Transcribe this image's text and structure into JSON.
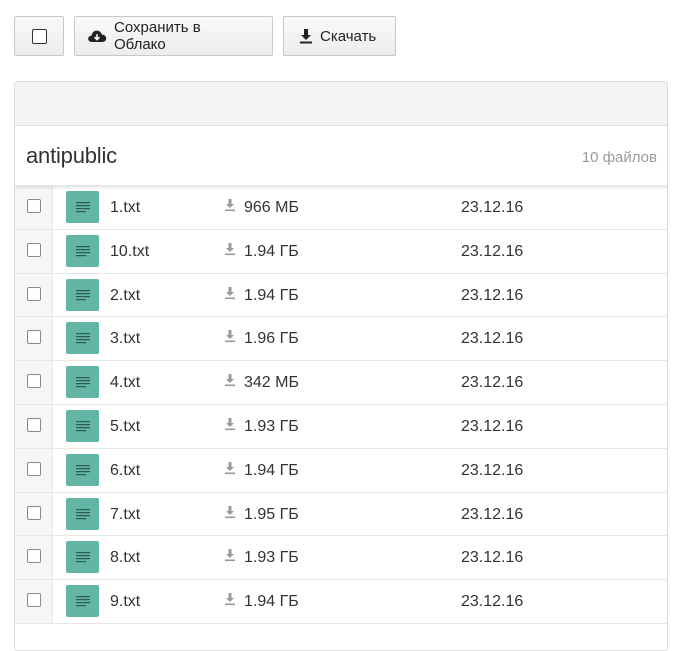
{
  "toolbar": {
    "save_label": "Сохранить в Облако",
    "download_label": "Скачать"
  },
  "folder": {
    "name": "antipublic",
    "count": "10 файлов"
  },
  "files": [
    {
      "name": "1.txt",
      "size": "966 МБ",
      "date": "23.12.16"
    },
    {
      "name": "10.txt",
      "size": "1.94 ГБ",
      "date": "23.12.16"
    },
    {
      "name": "2.txt",
      "size": "1.94 ГБ",
      "date": "23.12.16"
    },
    {
      "name": "3.txt",
      "size": "1.96 ГБ",
      "date": "23.12.16"
    },
    {
      "name": "4.txt",
      "size": "342 МБ",
      "date": "23.12.16"
    },
    {
      "name": "5.txt",
      "size": "1.93 ГБ",
      "date": "23.12.16"
    },
    {
      "name": "6.txt",
      "size": "1.94 ГБ",
      "date": "23.12.16"
    },
    {
      "name": "7.txt",
      "size": "1.95 ГБ",
      "date": "23.12.16"
    },
    {
      "name": "8.txt",
      "size": "1.93 ГБ",
      "date": "23.12.16"
    },
    {
      "name": "9.txt",
      "size": "1.94 ГБ",
      "date": "23.12.16"
    }
  ],
  "colors": {
    "file_icon": "#63b5a5"
  },
  "icons": {
    "save": "cloud-download-icon",
    "download": "download-icon",
    "file": "text-file-icon",
    "size": "download-arrow-icon"
  }
}
